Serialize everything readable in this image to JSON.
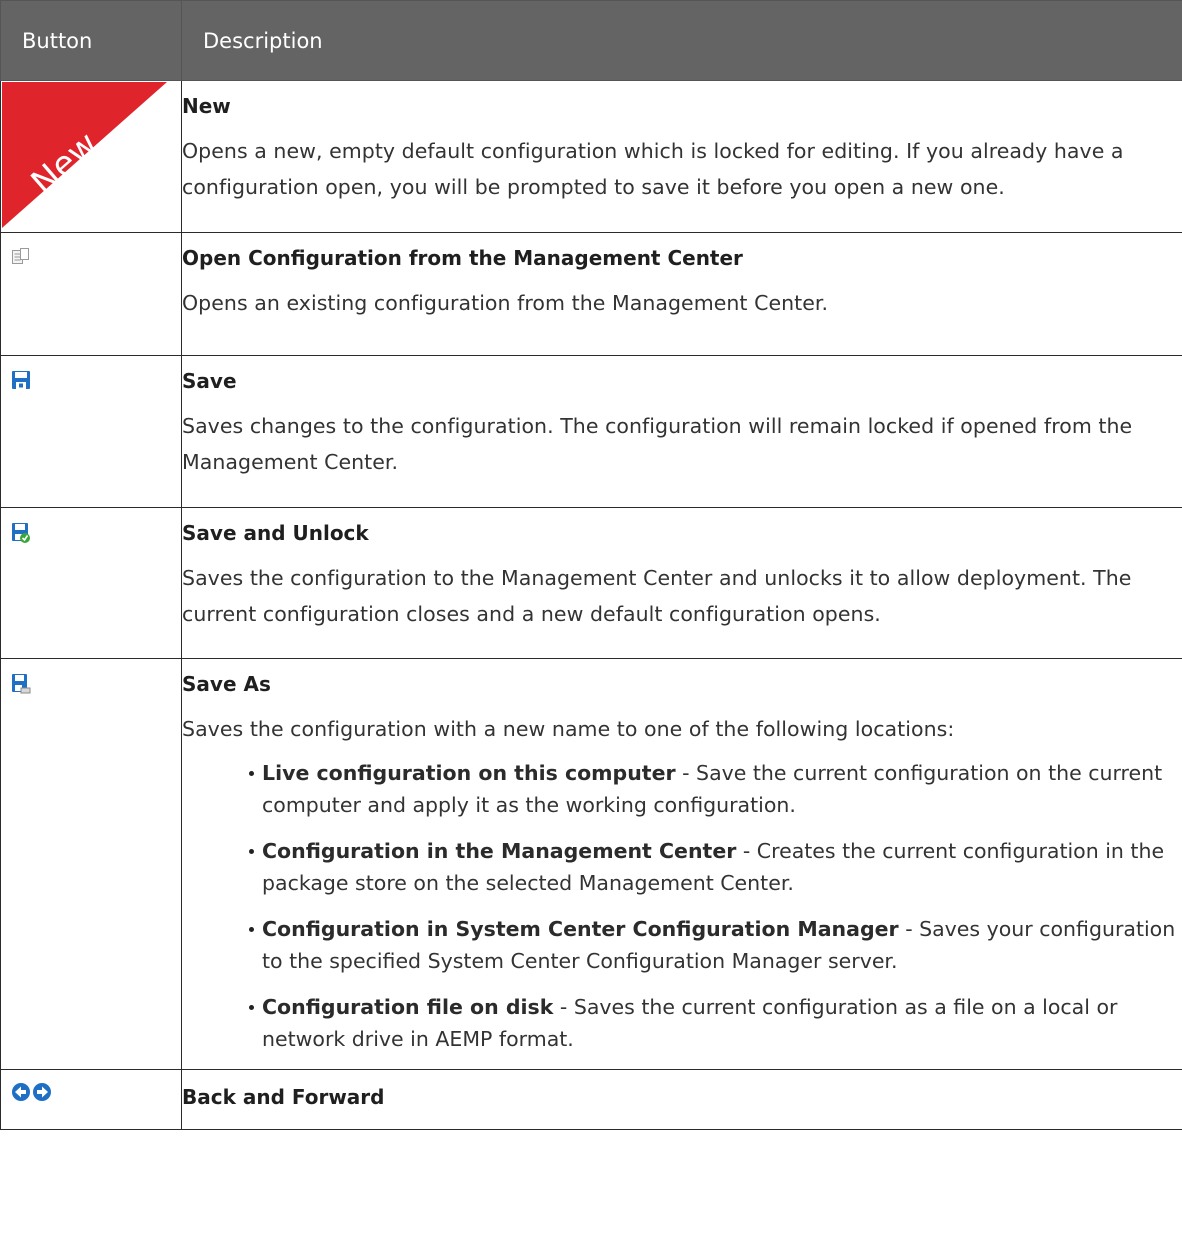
{
  "header": {
    "col_button": "Button",
    "col_description": "Description"
  },
  "rows": [
    {
      "icon": "new-ribbon-icon",
      "ribbon_text": "New",
      "title": "New",
      "description": "Opens a new, empty default configuration which is locked for editing. If you already have a configuration open, you will be prompted to save it before you open a new one."
    },
    {
      "icon": "open-configuration-icon",
      "title": "Open Configuration from the Management Center",
      "description": "Opens an existing configuration from the Management Center."
    },
    {
      "icon": "save-icon",
      "title": "Save",
      "description": "Saves changes to the configuration. The configuration will remain locked if opened from the Management Center."
    },
    {
      "icon": "save-and-unlock-icon",
      "title": "Save and Unlock",
      "description": "Saves the configuration to the Management Center and unlocks it to allow deployment. The current configuration closes and a new default configuration opens."
    },
    {
      "icon": "save-as-icon",
      "title": "Save As",
      "description": "Saves the configuration with a new name to one of the following locations:",
      "options": [
        {
          "term": "Live configuration on this computer",
          "text": " - Save the current configuration on the current computer and apply it as the working configuration."
        },
        {
          "term": "Configuration in the Management Center",
          "text": " - Creates the current configuration in the package store on the selected Management Center."
        },
        {
          "term": "Configuration in System Center Configuration Manager",
          "text": " - Saves your configuration to the specified System Center Configuration Manager server."
        },
        {
          "term": "Configuration file on disk",
          "text": " - Saves the current configuration as a file on a local or network drive in AEMP format."
        }
      ]
    },
    {
      "icon": "back-forward-icon",
      "title": "Back and Forward"
    }
  ],
  "colors": {
    "header_bg": "#646464",
    "ribbon_red": "#e0242b",
    "save_blue": "#1f6fc4"
  }
}
